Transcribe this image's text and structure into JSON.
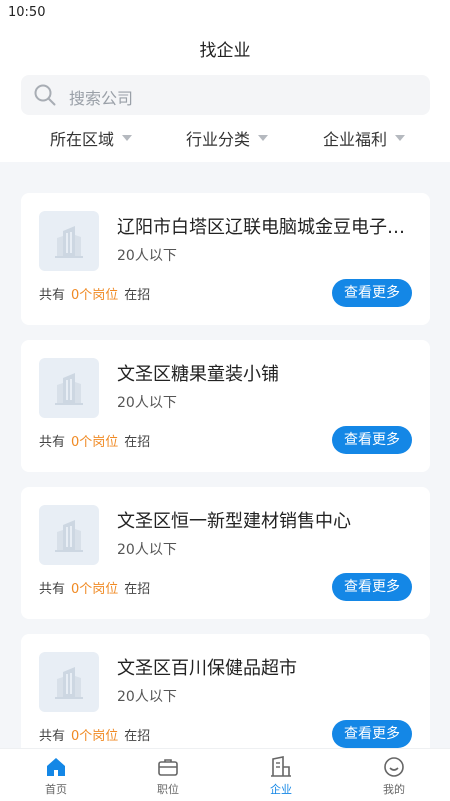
{
  "status_bar": {
    "time": "10:50"
  },
  "header": {
    "title": "找企业"
  },
  "search": {
    "placeholder": "搜索公司"
  },
  "filters": [
    {
      "label": "所在区域"
    },
    {
      "label": "行业分类"
    },
    {
      "label": "企业福利"
    }
  ],
  "companies": [
    {
      "name": "辽阳市白塔区辽联电脑城金豆电子产品经销部",
      "size": "20人以下",
      "jobs_prefix": "共有",
      "jobs_count": "0个岗位",
      "jobs_suffix": "在招",
      "button": "查看更多"
    },
    {
      "name": "文圣区糖果童装小铺",
      "size": "20人以下",
      "jobs_prefix": "共有",
      "jobs_count": "0个岗位",
      "jobs_suffix": "在招",
      "button": "查看更多"
    },
    {
      "name": "文圣区恒一新型建材销售中心",
      "size": "20人以下",
      "jobs_prefix": "共有",
      "jobs_count": "0个岗位",
      "jobs_suffix": "在招",
      "button": "查看更多"
    },
    {
      "name": "文圣区百川保健品超市",
      "size": "20人以下",
      "jobs_prefix": "共有",
      "jobs_count": "0个岗位",
      "jobs_suffix": "在招",
      "button": "查看更多"
    }
  ],
  "tabbar": [
    {
      "label": "首页",
      "icon": "home-icon",
      "active": false
    },
    {
      "label": "职位",
      "icon": "briefcase-icon",
      "active": false
    },
    {
      "label": "企业",
      "icon": "building-icon",
      "active": true
    },
    {
      "label": "我的",
      "icon": "profile-icon",
      "active": false
    }
  ],
  "colors": {
    "accent": "#1487e6",
    "highlight": "#f08a24",
    "background": "#f4f6f9"
  }
}
